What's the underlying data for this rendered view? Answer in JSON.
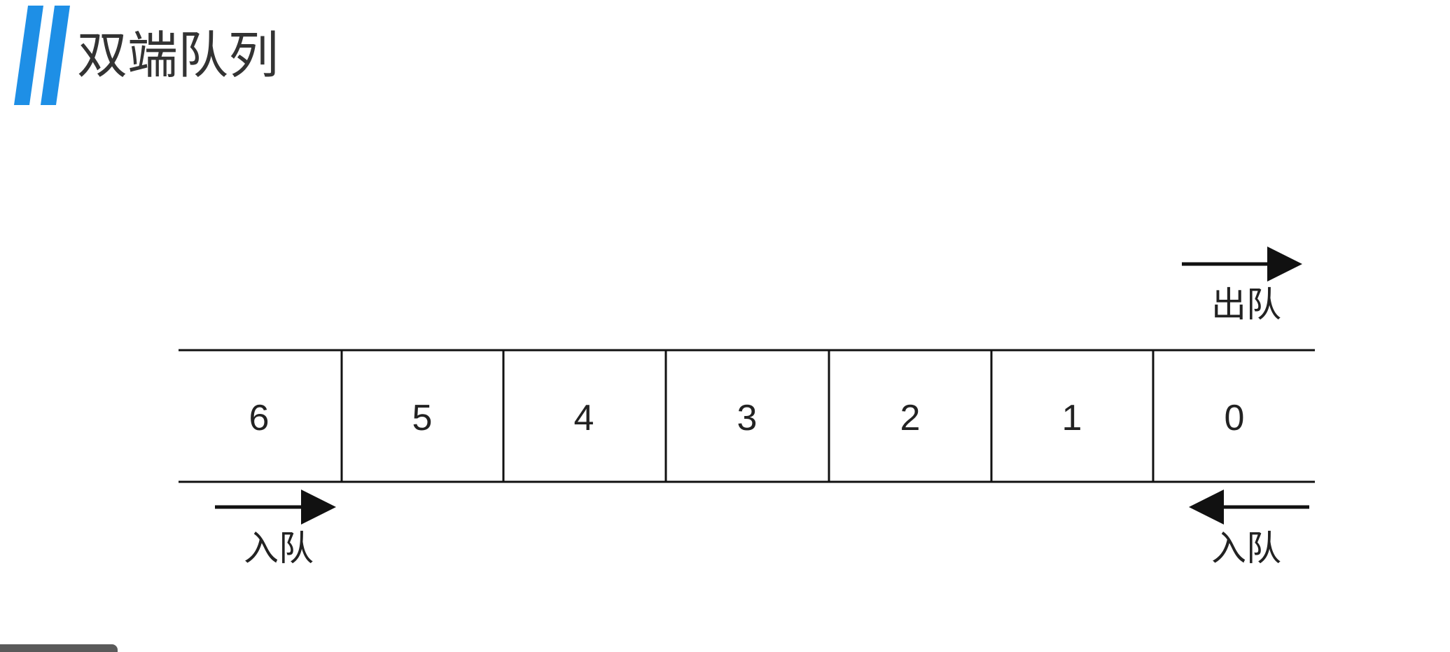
{
  "title": "双端队列",
  "accent_color": "#1e8fe6",
  "cells": [
    "6",
    "5",
    "4",
    "3",
    "2",
    "1",
    "0"
  ],
  "labels": {
    "dequeue_top_right": "出队",
    "enqueue_bottom_left": "入队",
    "enqueue_bottom_right": "入队"
  },
  "icons": {
    "title_marker": "double-slash-icon",
    "arrow_right": "arrow-right-icon",
    "arrow_left": "arrow-left-icon"
  }
}
